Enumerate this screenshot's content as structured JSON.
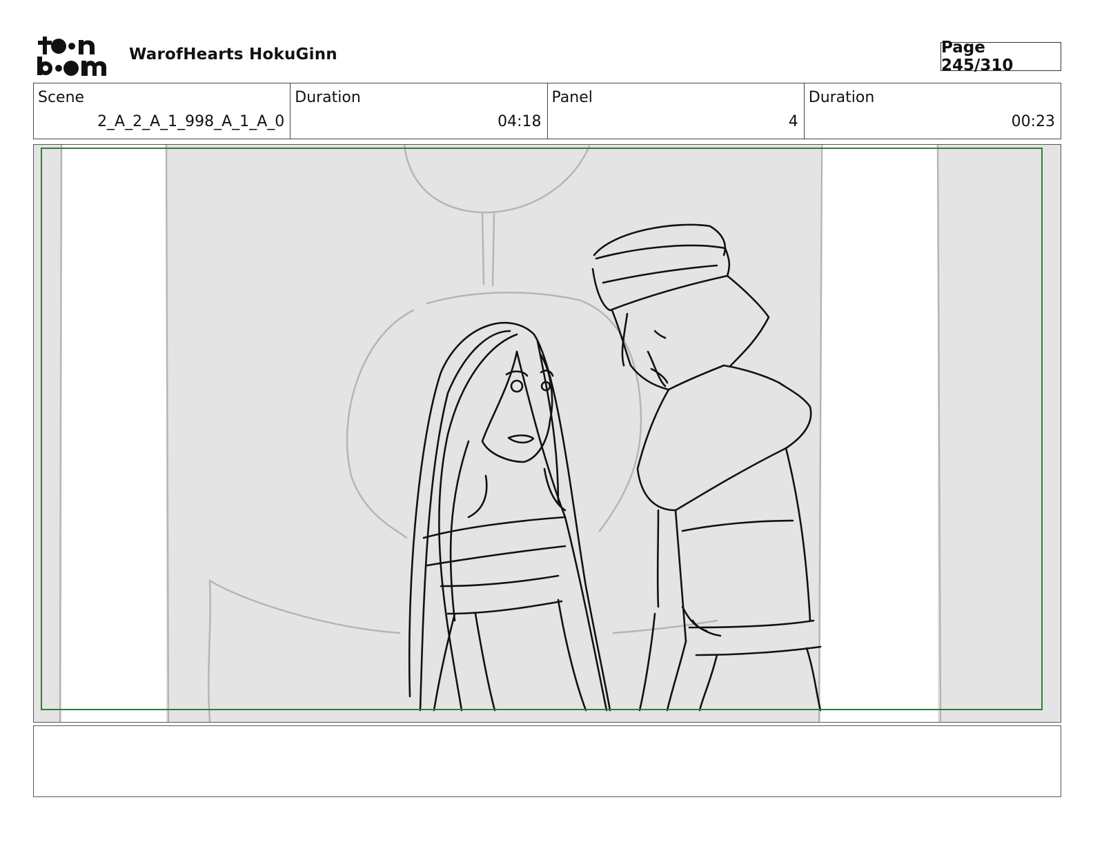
{
  "header": {
    "logo_text": "toon boom",
    "project_title": "WarofHearts HokuGinn",
    "page_label": "Page 245/310"
  },
  "info": {
    "scene_label": "Scene",
    "scene_value": "2_A_2_A_1_998_A_1_A_0",
    "scene_duration_label": "Duration",
    "scene_duration_value": "04:18",
    "panel_label": "Panel",
    "panel_value": "4",
    "panel_duration_label": "Duration",
    "panel_duration_value": "00:23"
  },
  "panel": {
    "safe_frame_color": "#2e7d32",
    "background_color": "#e4e4e4"
  },
  "notes": {
    "text": ""
  }
}
